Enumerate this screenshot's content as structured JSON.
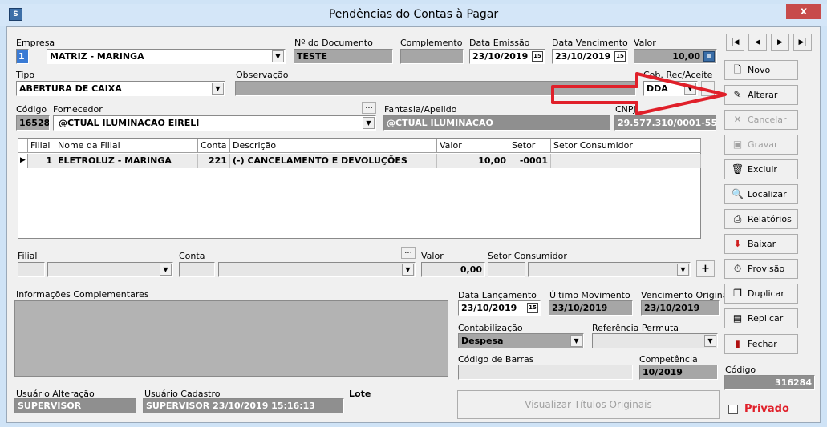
{
  "window": {
    "title": "Pendências do Contas à Pagar",
    "close_glyph": "x",
    "app_icon_text": "S"
  },
  "empresa": {
    "label": "Empresa",
    "code": "1",
    "name": "MATRIZ - MARINGA"
  },
  "documento": {
    "label": "Nº do Documento",
    "value": "TESTE"
  },
  "complemento": {
    "label": "Complemento",
    "value": ""
  },
  "data_emissao": {
    "label": "Data Emissão",
    "value": "23/10/2019"
  },
  "data_vencimento": {
    "label": "Data Vencimento",
    "value": "23/10/2019"
  },
  "valor": {
    "label": "Valor",
    "value": "10,00"
  },
  "tipo": {
    "label": "Tipo",
    "value": "ABERTURA DE CAIXA"
  },
  "observacao": {
    "label": "Observação",
    "value": ""
  },
  "cob_rec": {
    "label": "Cob. Rec/Aceite",
    "value": "DDA"
  },
  "codigo_fornecedor": {
    "label": "Código",
    "value": "16528"
  },
  "fornecedor": {
    "label": "Fornecedor",
    "value": "@CTUAL ILUMINACAO EIRELI",
    "ellipsis": "..."
  },
  "fantasia": {
    "label": "Fantasia/Apelido",
    "value": "@CTUAL ILUMINACAO"
  },
  "cnpj": {
    "label": "CNPJ",
    "value": "29.577.310/0001-55"
  },
  "grid": {
    "columns": [
      "Filial",
      "Nome da Filial",
      "Conta",
      "Descrição",
      "Valor",
      "Setor",
      "Setor Consumidor"
    ],
    "rows": [
      {
        "filial": "1",
        "nome": "ELETROLUZ - MARINGA",
        "conta": "221",
        "descricao": "(-) CANCELAMENTO E DEVOLUÇÕES",
        "valor": "10,00",
        "setor": "-0001",
        "setor_consumidor": ""
      }
    ]
  },
  "rateio": {
    "filial_label": "Filial",
    "conta_label": "Conta",
    "valor_label": "Valor",
    "valor_value": "0,00",
    "setor_label": "Setor Consumidor",
    "ellipsis": "...",
    "plus": "+"
  },
  "info": {
    "label": "Informações Complementares"
  },
  "data_lancamento": {
    "label": "Data Lançamento",
    "value": "23/10/2019"
  },
  "ultimo_movimento": {
    "label": "Último Movimento",
    "value": "23/10/2019"
  },
  "vencimento_original": {
    "label": "Vencimento Original",
    "value": "23/10/2019"
  },
  "contabilizacao": {
    "label": "Contabilização",
    "value": "Despesa"
  },
  "ref_permuta": {
    "label": "Referência Permuta",
    "value": ""
  },
  "codigo_barras": {
    "label": "Código de Barras",
    "value": ""
  },
  "competencia": {
    "label": "Competência",
    "value": "10/2019"
  },
  "usuario_alteracao": {
    "label": "Usuário Alteração",
    "value": "SUPERVISOR"
  },
  "usuario_cadastro": {
    "label": "Usuário Cadastro",
    "value": "SUPERVISOR 23/10/2019 15:16:13"
  },
  "lote": {
    "label": "Lote"
  },
  "viz_button": "Visualizar Títulos Originais",
  "nav": {
    "first": "|◀",
    "prev": "◀",
    "next": "▶",
    "last": "▶|"
  },
  "buttons": {
    "novo": "Novo",
    "alterar": "Alterar",
    "cancelar": "Cancelar",
    "gravar": "Gravar",
    "excluir": "Excluir",
    "localizar": "Localizar",
    "relatorios": "Relatórios",
    "baixar": "Baixar",
    "provisao": "Provisão",
    "duplicar": "Duplicar",
    "replicar": "Replicar",
    "fechar": "Fechar"
  },
  "codigo_side": {
    "label": "Código",
    "value": "316284"
  },
  "privado": {
    "label": "Privado",
    "checked": false
  },
  "colors": {
    "arrow": "#e0202a",
    "privado": "#e0202a"
  }
}
